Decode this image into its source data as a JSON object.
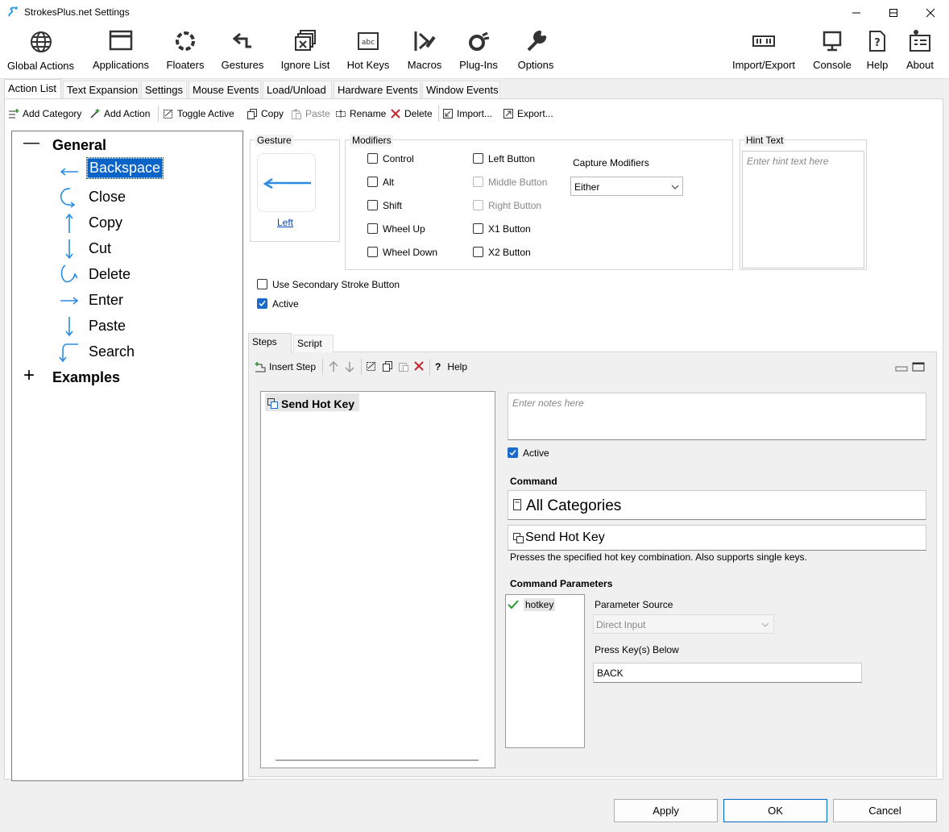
{
  "window": {
    "title": "StrokesPlus.net Settings"
  },
  "main_toolbar": {
    "items": [
      {
        "label": "Global Actions",
        "icon": "globe-icon"
      },
      {
        "label": "Applications",
        "icon": "window-icon"
      },
      {
        "label": "Floaters",
        "icon": "floater-icon"
      },
      {
        "label": "Gestures",
        "icon": "gesture-icon"
      },
      {
        "label": "Ignore List",
        "icon": "ignore-list-icon"
      },
      {
        "label": "Hot Keys",
        "icon": "hotkey-icon"
      },
      {
        "label": "Macros",
        "icon": "macros-icon"
      },
      {
        "label": "Plug-Ins",
        "icon": "plugin-icon"
      },
      {
        "label": "Options",
        "icon": "wrench-icon"
      },
      {
        "label": "Import/Export",
        "icon": "import-export-icon"
      },
      {
        "label": "Console",
        "icon": "console-icon"
      },
      {
        "label": "Help",
        "icon": "help-icon"
      },
      {
        "label": "About",
        "icon": "about-icon"
      }
    ]
  },
  "tabs": [
    "Action List",
    "Text Expansion",
    "Settings",
    "Mouse Events",
    "Load/Unload",
    "Hardware Events",
    "Window Events"
  ],
  "action_toolbar": {
    "add_category": "Add Category",
    "add_action": "Add Action",
    "toggle_active": "Toggle Active",
    "copy": "Copy",
    "paste": "Paste",
    "rename": "Rename",
    "delete": "Delete",
    "import": "Import...",
    "export": "Export..."
  },
  "tree": {
    "groups": [
      {
        "label": "General",
        "expander": "—"
      },
      {
        "label": "Examples",
        "expander": "+"
      }
    ],
    "actions": [
      "Backspace",
      "Close",
      "Copy",
      "Cut",
      "Delete",
      "Enter",
      "Paste",
      "Search"
    ],
    "selected": "Backspace"
  },
  "gesture": {
    "group_label": "Gesture",
    "name": "Left"
  },
  "modifiers": {
    "group_label": "Modifiers",
    "left_col": [
      "Control",
      "Alt",
      "Shift",
      "Wheel Up",
      "Wheel Down"
    ],
    "right_col": [
      "Left Button",
      "Middle Button",
      "Right Button",
      "X1 Button",
      "X2 Button"
    ],
    "capture_label": "Capture Modifiers",
    "capture_value": "Either"
  },
  "hint": {
    "group_label": "Hint Text",
    "placeholder": "Enter hint text here"
  },
  "options": {
    "secondary": "Use Secondary Stroke Button",
    "active": "Active"
  },
  "steps": {
    "tabs": [
      "Steps",
      "Script"
    ],
    "insert_step": "Insert Step",
    "help": "Help",
    "step_item": "Send Hot Key",
    "notes_placeholder": "Enter notes here",
    "active": "Active",
    "command_label": "Command",
    "category_value": "All Categories",
    "command_value": "Send Hot Key",
    "command_desc": "Presses the specified hot key combination. Also supports single keys.",
    "params_label": "Command Parameters",
    "param_item": "hotkey",
    "param_source_label": "Parameter Source",
    "param_source_value": "Direct Input",
    "press_keys_label": "Press Key(s) Below",
    "press_keys_value": "BACK"
  },
  "buttons": {
    "apply": "Apply",
    "ok": "OK",
    "cancel": "Cancel"
  },
  "colors": {
    "accent": "#1b6ac9",
    "icon_blue": "#2b8ce6",
    "selected_bg": "#0a64c8"
  }
}
